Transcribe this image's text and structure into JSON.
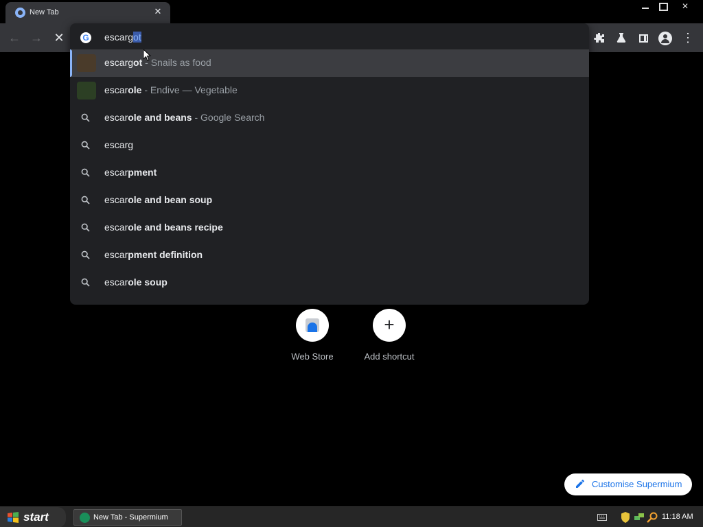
{
  "browser": {
    "tab_title": "New Tab",
    "tab_close_symbol": "✕"
  },
  "omnibox": {
    "typed_text": "escarg",
    "autocomplete_text": "ot",
    "suggestions": [
      {
        "kind": "entity",
        "match": "escarg",
        "bold": "ot",
        "description": " - Snails as food",
        "thumb_color": "#4a3b2a",
        "active": true
      },
      {
        "kind": "entity",
        "match": "escar",
        "bold": "ole",
        "description": " - Endive — Vegetable",
        "thumb_color": "#2c3f24",
        "active": false
      },
      {
        "kind": "search",
        "match": "escar",
        "bold": "ole and beans",
        "description": " - Google Search"
      },
      {
        "kind": "search",
        "match": "escarg",
        "bold": "",
        "description": ""
      },
      {
        "kind": "search",
        "match": "escar",
        "bold": "pment",
        "description": ""
      },
      {
        "kind": "search",
        "match": "escar",
        "bold": "ole and bean soup",
        "description": ""
      },
      {
        "kind": "search",
        "match": "escar",
        "bold": "ole and beans recipe",
        "description": ""
      },
      {
        "kind": "search",
        "match": "escar",
        "bold": "pment definition",
        "description": ""
      },
      {
        "kind": "search",
        "match": "escar",
        "bold": "ole soup",
        "description": ""
      }
    ]
  },
  "shortcuts": [
    {
      "label": "Web Store",
      "icon": "web-store-icon"
    },
    {
      "label": "Add shortcut",
      "icon": "plus-icon"
    }
  ],
  "customise_button": {
    "label": "Customise Supermium",
    "icon": "pencil-icon"
  },
  "taskbar": {
    "start_label": "start",
    "task_label": "New Tab - Supermium",
    "clock": "11:18 AM"
  },
  "colors": {
    "accent": "#8ab4f8",
    "omnibox_bg": "#202124",
    "toolbar_bg": "#35363a",
    "link_blue": "#1a73e8"
  }
}
